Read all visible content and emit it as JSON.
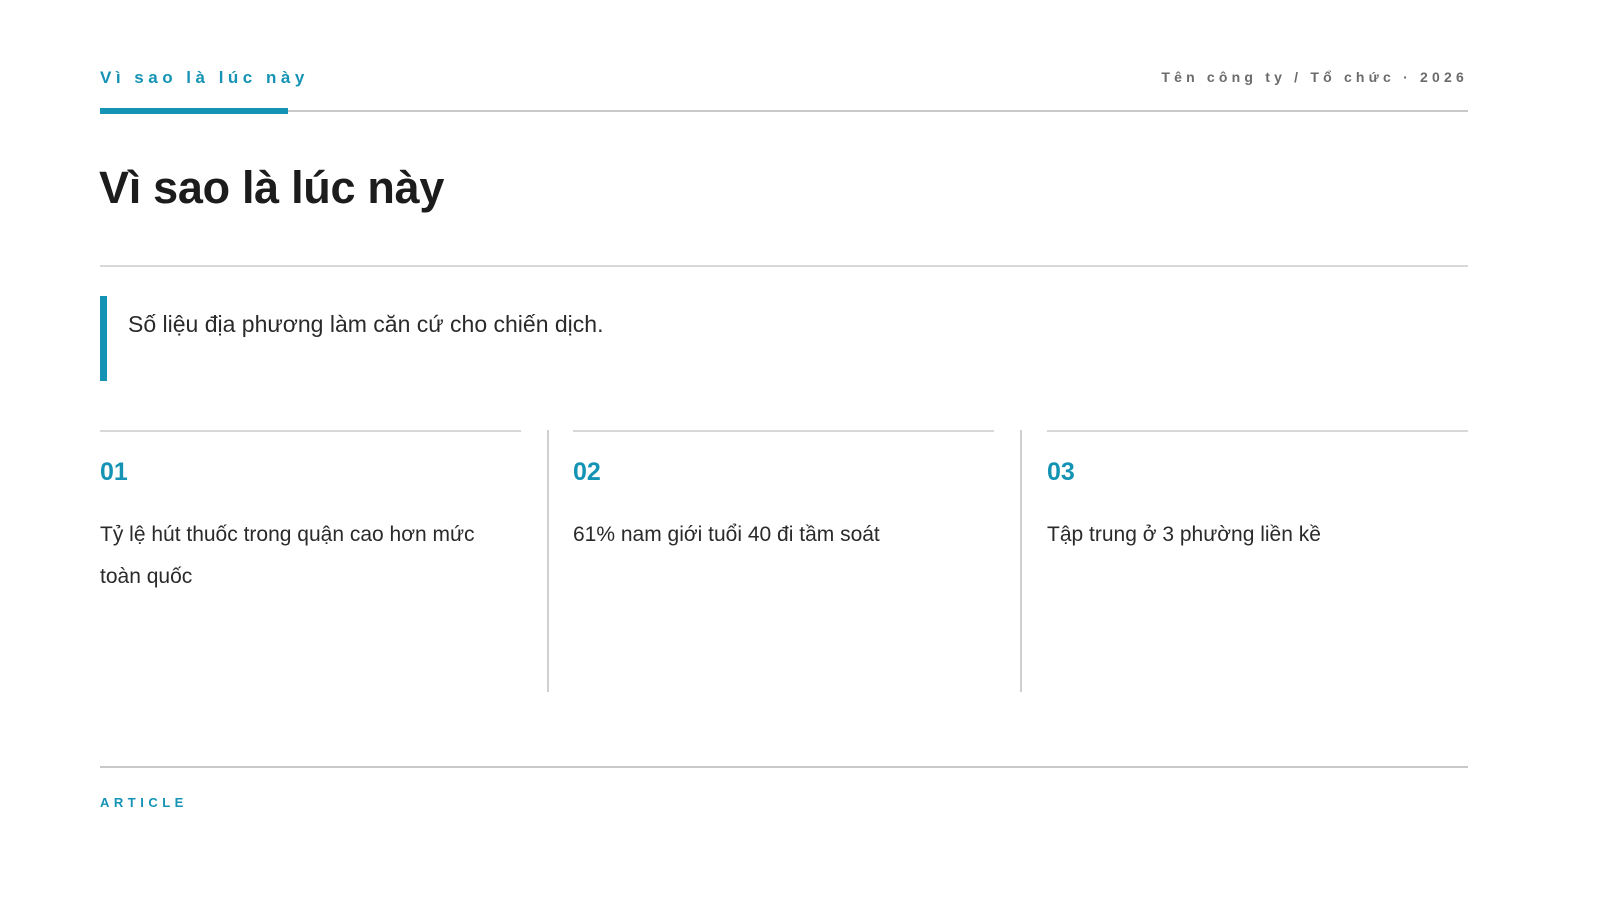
{
  "header": {
    "kicker": "Vì sao là lúc này",
    "organization": "Tên công ty / Tổ chức · 2026"
  },
  "title": "Vì sao là lúc này",
  "lead": "Số liệu địa phương làm căn cứ cho chiến dịch.",
  "points": [
    {
      "number": "01",
      "text": "Tỷ lệ hút thuốc trong quận cao hơn mức toàn quốc"
    },
    {
      "number": "02",
      "text": "61% nam giới tuổi 40 đi tầm soát"
    },
    {
      "number": "03",
      "text": "Tập trung ở 3 phường liền kề"
    }
  ],
  "footer": {
    "label": "ARTICLE"
  },
  "colors": {
    "accent": "#1593b4",
    "text": "#1c1c1c",
    "muted": "#6b6b6b",
    "rule": "#d8d8d8"
  }
}
